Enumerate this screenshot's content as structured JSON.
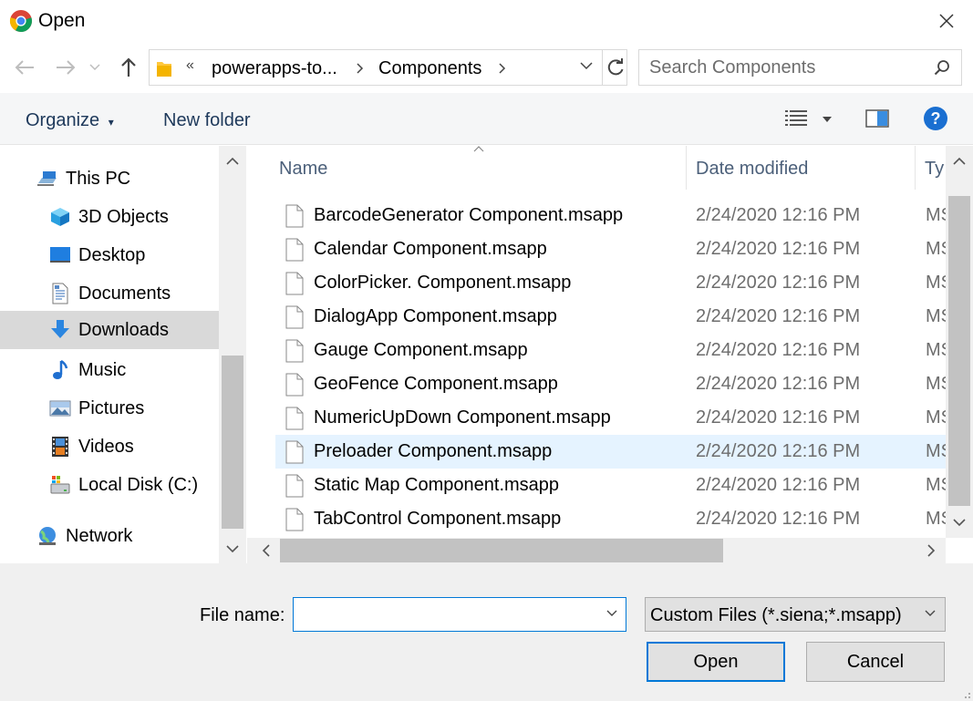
{
  "window": {
    "title": "Open"
  },
  "nav": {
    "back_label": "←",
    "forward_label": "→",
    "recent_label": "⌄",
    "up_label": "↑"
  },
  "address": {
    "overflow": "«",
    "crumbs": [
      "powerapps-to...",
      "Components"
    ]
  },
  "search": {
    "placeholder": "Search Components"
  },
  "toolbar": {
    "organize": "Organize",
    "organize_caret": "▾",
    "new_folder": "New folder",
    "help": "?"
  },
  "sidebar": {
    "items": [
      {
        "label": "This PC",
        "icon": "computer-icon"
      },
      {
        "label": "3D Objects",
        "icon": "cube-icon"
      },
      {
        "label": "Desktop",
        "icon": "desktop-icon"
      },
      {
        "label": "Documents",
        "icon": "document-icon"
      },
      {
        "label": "Downloads",
        "icon": "download-arrow-icon",
        "selected": true
      },
      {
        "label": "Music",
        "icon": "music-note-icon"
      },
      {
        "label": "Pictures",
        "icon": "picture-icon"
      },
      {
        "label": "Videos",
        "icon": "film-icon"
      },
      {
        "label": "Local Disk (C:)",
        "icon": "disk-icon"
      },
      {
        "label": "Network",
        "icon": "network-globe-icon"
      }
    ]
  },
  "columns": {
    "name": "Name",
    "date": "Date modified",
    "type": "Ty"
  },
  "files": [
    {
      "name": "BarcodeGenerator Component.msapp",
      "date": "2/24/2020 12:16 PM",
      "type": "MS"
    },
    {
      "name": "Calendar Component.msapp",
      "date": "2/24/2020 12:16 PM",
      "type": "MS"
    },
    {
      "name": "ColorPicker. Component.msapp",
      "date": "2/24/2020 12:16 PM",
      "type": "MS"
    },
    {
      "name": "DialogApp Component.msapp",
      "date": "2/24/2020 12:16 PM",
      "type": "MS"
    },
    {
      "name": "Gauge Component.msapp",
      "date": "2/24/2020 12:16 PM",
      "type": "MS"
    },
    {
      "name": "GeoFence Component.msapp",
      "date": "2/24/2020 12:16 PM",
      "type": "MS"
    },
    {
      "name": "NumericUpDown Component.msapp",
      "date": "2/24/2020 12:16 PM",
      "type": "MS"
    },
    {
      "name": "Preloader Component.msapp",
      "date": "2/24/2020 12:16 PM",
      "type": "MS",
      "hover": true
    },
    {
      "name": "Static Map Component.msapp",
      "date": "2/24/2020 12:16 PM",
      "type": "MS"
    },
    {
      "name": "TabControl Component.msapp",
      "date": "2/24/2020 12:16 PM",
      "type": "MS"
    }
  ],
  "footer": {
    "file_name_label": "File name:",
    "file_name_value": "",
    "filter": "Custom Files (*.siena;*.msapp)",
    "open": "Open",
    "cancel": "Cancel"
  },
  "colors": {
    "accent": "#0078d7",
    "hover_row": "#e5f3ff",
    "selected_nav": "#d9d9d9",
    "toolbar_bg": "#f5f6f7"
  }
}
